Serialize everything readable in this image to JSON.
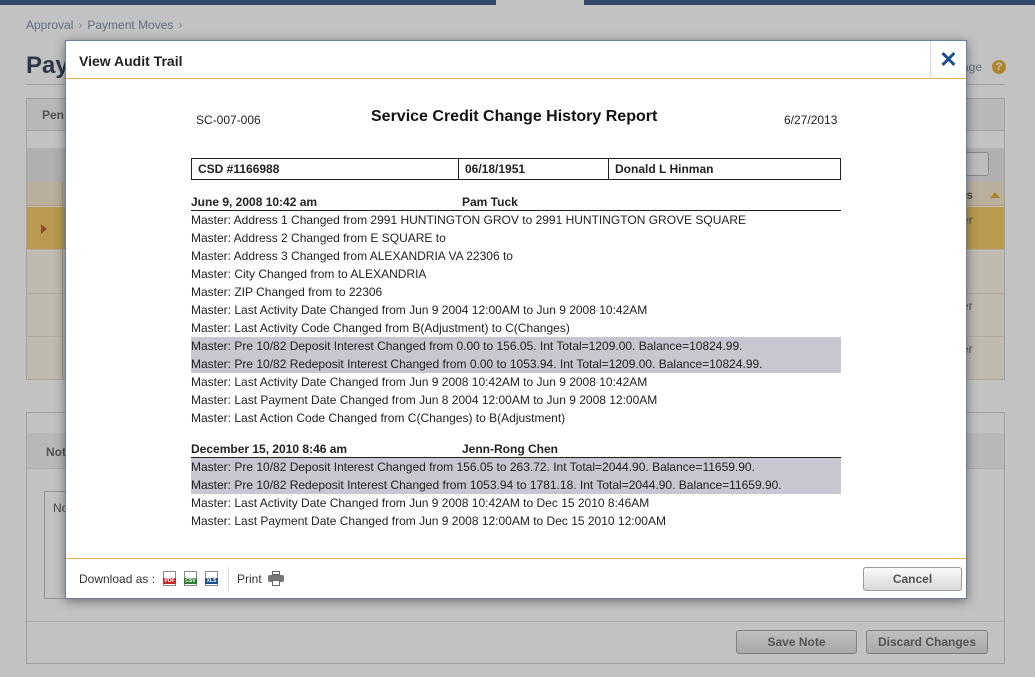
{
  "background": {
    "breadcrumb": [
      "Approval",
      "Payment Moves"
    ],
    "page_title": "Pay",
    "help_text": "age",
    "tab_label": "Pen",
    "grid_status_header": "tus",
    "row_texts": [
      "er",
      "er",
      "er"
    ],
    "notes_tab": "Not",
    "notes_label": "No",
    "save_button": "Save Note",
    "discard_button": "Discard Changes"
  },
  "modal": {
    "title": "View Audit Trail",
    "close_symbol": "✕",
    "report": {
      "id": "SC-007-006",
      "title": "Service Credit Change History Report",
      "date": "6/27/2013",
      "info": {
        "csd": "CSD #1166988",
        "birth_date": "06/18/1951",
        "name": "Donald L Hinman"
      },
      "sections": [
        {
          "date": "June 9, 2008 10:42 am",
          "user": "Pam Tuck",
          "lines": [
            {
              "text": "Master: Address 1 Changed from 2991 HUNTINGTON GROV to 2991 HUNTINGTON GROVE SQUARE",
              "highlight": false
            },
            {
              "text": "Master: Address 2 Changed from E SQUARE to",
              "highlight": false
            },
            {
              "text": "Master: Address 3 Changed from ALEXANDRIA VA 22306 to",
              "highlight": false
            },
            {
              "text": "Master: City Changed from to ALEXANDRIA",
              "highlight": false
            },
            {
              "text": "Master: ZIP Changed from to 22306",
              "highlight": false
            },
            {
              "text": "Master: Last Activity Date Changed from Jun 9 2004 12:00AM to Jun 9 2008 10:42AM",
              "highlight": false
            },
            {
              "text": "Master: Last Activity Code Changed from B(Adjustment) to C(Changes)",
              "highlight": false
            },
            {
              "text": "Master: Pre 10/82 Deposit Interest Changed from 0.00 to 156.05. Int Total=1209.00. Balance=10824.99.",
              "highlight": true
            },
            {
              "text": "Master: Pre 10/82 Redeposit Interest Changed from 0.00 to 1053.94. Int Total=1209.00. Balance=10824.99.",
              "highlight": true
            },
            {
              "text": "Master: Last Activity Date Changed from Jun 9 2008 10:42AM to Jun 9 2008 10:42AM",
              "highlight": false
            },
            {
              "text": "Master: Last Payment Date Changed from Jun 8 2004 12:00AM to Jun 9 2008 12:00AM",
              "highlight": false
            },
            {
              "text": "Master: Last Action Code Changed from C(Changes) to B(Adjustment)",
              "highlight": false
            }
          ]
        },
        {
          "date": "December 15, 2010 8:46 am",
          "user": "Jenn-Rong Chen",
          "lines": [
            {
              "text": "Master: Pre 10/82 Deposit Interest Changed from 156.05 to 263.72. Int Total=2044.90. Balance=11659.90.",
              "highlight": true
            },
            {
              "text": "Master: Pre 10/82 Redeposit Interest Changed from 1053.94 to 1781.18. Int Total=2044.90. Balance=11659.90.",
              "highlight": true
            },
            {
              "text": "Master: Last Activity Date Changed from Jun 9 2008 10:42AM to Dec 15 2010 8:46AM",
              "highlight": false
            },
            {
              "text": "Master: Last Payment Date Changed from Jun 9 2008 12:00AM to Dec 15 2010 12:00AM",
              "highlight": false
            }
          ]
        }
      ]
    },
    "footer": {
      "download_label": "Download as :",
      "download_icons": [
        "pdf-icon",
        "csv-icon",
        "xls-icon"
      ],
      "print_label": "Print",
      "cancel_button": "Cancel"
    }
  },
  "colors": {
    "accent": "#e3b250",
    "brand": "#1f3f74",
    "highlight_row": "#c7c7cf",
    "selected_row": "#f2c24e"
  }
}
